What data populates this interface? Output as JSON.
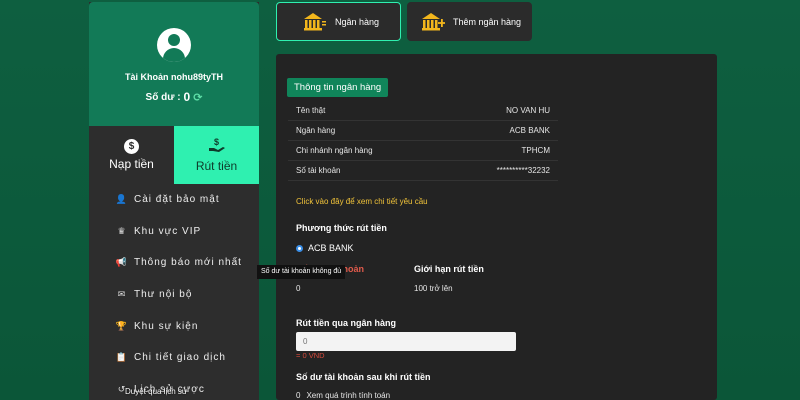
{
  "profile": {
    "account_name": "Tài Khoản nohu89tyTH",
    "balance_label": "Số dư :",
    "balance_value": "0"
  },
  "tabs": {
    "deposit": "Nạp tiền",
    "withdraw": "Rút tiền"
  },
  "menu": [
    {
      "label": "Cài đặt bảo mật",
      "icon": "user-gear-icon"
    },
    {
      "label": "Khu vực VIP",
      "icon": "crown-icon"
    },
    {
      "label": "Thông báo mới nhất",
      "icon": "megaphone-icon"
    },
    {
      "label": "Thư nội bộ",
      "icon": "envelope-icon"
    },
    {
      "label": "Khu sự kiện",
      "icon": "trophy-icon"
    },
    {
      "label": "Chi tiết giao dịch",
      "icon": "clipboard-icon"
    },
    {
      "label": "Lịch sử cược",
      "icon": "history-icon"
    }
  ],
  "top_buttons": {
    "bank": "Ngân hàng",
    "add_bank": "Thêm ngân hàng"
  },
  "bank_info": {
    "title": "Thông tin ngân hàng",
    "rows": [
      {
        "label": "Tên thật",
        "value": "NO VAN HU"
      },
      {
        "label": "Ngân hàng",
        "value": "ACB BANK"
      },
      {
        "label": "Chi nhánh ngân hàng",
        "value": "TPHCM"
      },
      {
        "label": "Số tài khoản",
        "value": "**********32232"
      }
    ],
    "detail_link": "Click vào đây để xem chi tiết yêu cầu"
  },
  "withdraw": {
    "method_heading": "Phương thức rút tiền",
    "method_option": "ACB BANK",
    "balance_heading": "Số dư tài khoản",
    "balance_value": "0",
    "limit_heading": "Giới hạn rút tiền",
    "limit_value": "100 trở lên",
    "bank_heading": "Rút tiền qua ngân hàng",
    "amount_placeholder": "0",
    "amount_vnd": "= 0 VND",
    "after_heading": "Số dư tài khoản sau khi rút tiền",
    "after_value": "0",
    "after_link": "Xem quá trình tính toán"
  },
  "tooltip": "Số dư tài khoản không đủ",
  "bottom_tip": "Duyệt qua lịch sử",
  "colors": {
    "background": "#0d5a3c",
    "accent": "#2ff0b0",
    "profile": "#127a57",
    "warning": "#f2c43a",
    "error": "#e05a4b"
  }
}
